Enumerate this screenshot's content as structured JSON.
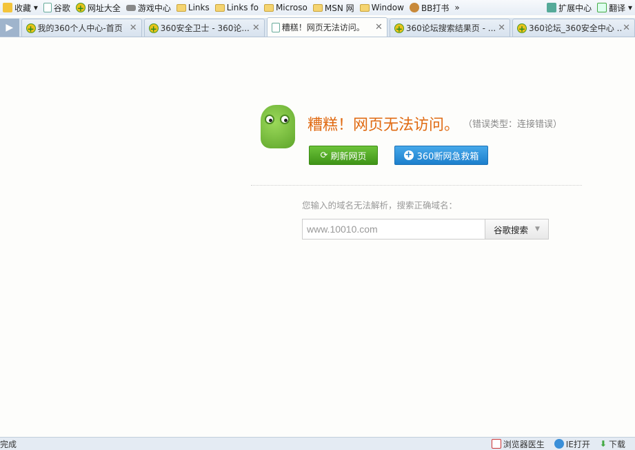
{
  "bookmarks": [
    "收藏",
    "谷歌",
    "网址大全",
    "游戏中心",
    "Links",
    "Links fo",
    "Microso",
    "MSN 网",
    "Window",
    "BB打书"
  ],
  "bookmarks_more": "»",
  "bookmarks_right": [
    "扩展中心",
    "翻译"
  ],
  "tabs": [
    {
      "title": "我的360个人中心-首页"
    },
    {
      "title": "360安全卫士 - 360论..."
    },
    {
      "title": "糟糕！网页无法访问。",
      "active": true
    },
    {
      "title": "360论坛搜索结果页 - ..."
    },
    {
      "title": "360论坛_360安全中心 ..."
    }
  ],
  "error": {
    "title": "糟糕！网页无法访问。",
    "type": "（错误类型：连接错误）",
    "refresh": "刷新网页",
    "rescue": "360断网急救箱",
    "hint": "您输入的域名无法解析，搜索正确域名：",
    "query": "www.10010.com",
    "search_engine": "谷歌搜索"
  },
  "status": {
    "text": "完成",
    "items": [
      "浏览器医生",
      "IE打开",
      "下载"
    ]
  }
}
